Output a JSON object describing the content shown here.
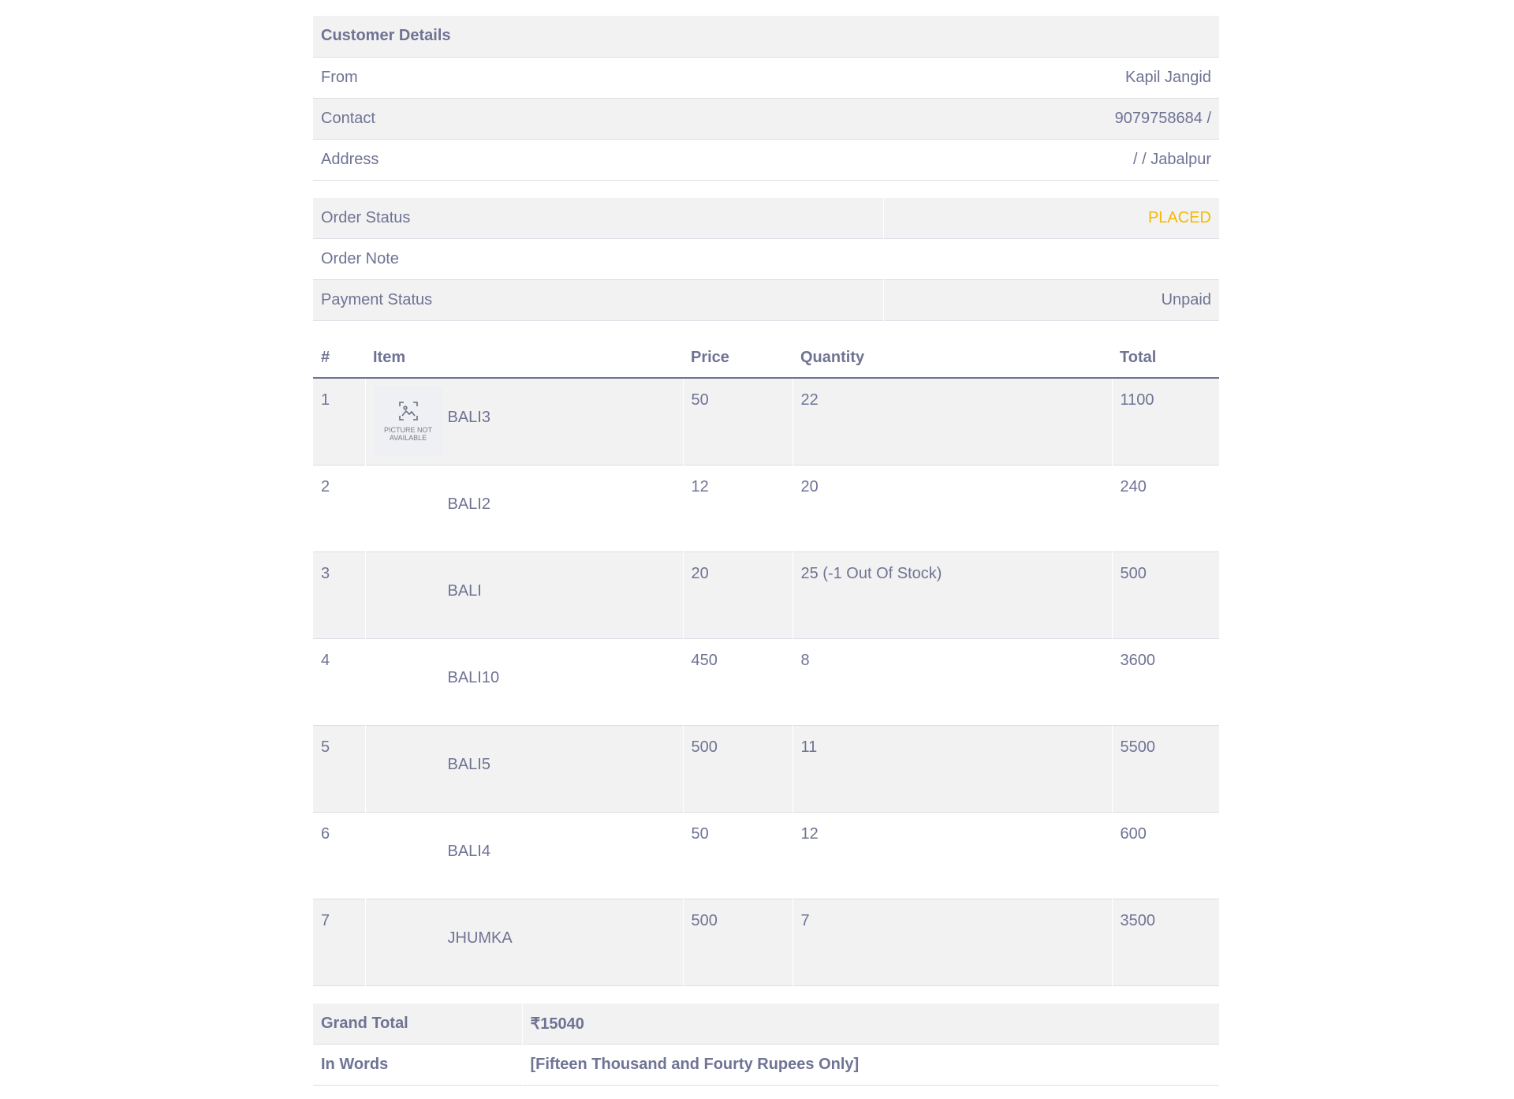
{
  "customer": {
    "heading": "Customer Details",
    "rows": [
      {
        "label": "From",
        "value": "Kapil Jangid"
      },
      {
        "label": "Contact",
        "value": "9079758684 /"
      },
      {
        "label": "Address",
        "value": "/ / Jabalpur"
      }
    ]
  },
  "order": {
    "status_label": "Order Status",
    "status_value": "PLACED",
    "note_label": "Order Note",
    "note_value": "",
    "payment_label": "Payment Status",
    "payment_value": "Unpaid",
    "status_color": "#f5b800"
  },
  "items": {
    "headers": [
      "#",
      "Item",
      "Price",
      "Quantity",
      "Total"
    ],
    "image_placeholder": [
      "PICTURE NOT",
      "AVAILABLE"
    ],
    "rows": [
      {
        "no": "1",
        "name": "BALI3",
        "price": "50",
        "qty": "22",
        "total": "1100",
        "has_image": true
      },
      {
        "no": "2",
        "name": "BALI2",
        "price": "12",
        "qty": "20",
        "total": "240"
      },
      {
        "no": "3",
        "name": "BALI",
        "price": "20",
        "qty": "25 (-1 Out Of Stock)",
        "total": "500"
      },
      {
        "no": "4",
        "name": "BALI10",
        "price": "450",
        "qty": "8",
        "total": "3600"
      },
      {
        "no": "5",
        "name": "BALI5",
        "price": "500",
        "qty": "11",
        "total": "5500"
      },
      {
        "no": "6",
        "name": "BALI4",
        "price": "50",
        "qty": "12",
        "total": "600"
      },
      {
        "no": "7",
        "name": "JHUMKA",
        "price": "500",
        "qty": "7",
        "total": "3500"
      }
    ]
  },
  "totals": {
    "grand_label": "Grand Total",
    "grand_value": "₹15040",
    "words_label": "In Words",
    "words_value": "[Fifteen Thousand and Fourty Rupees Only]"
  }
}
